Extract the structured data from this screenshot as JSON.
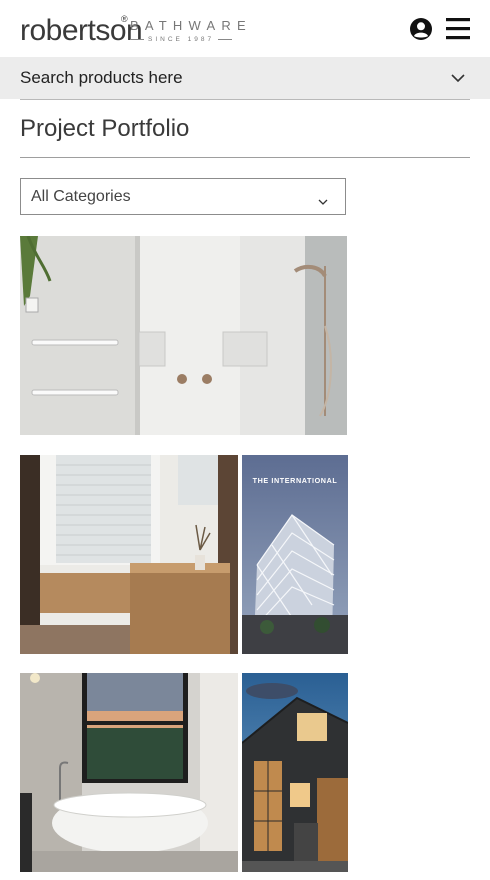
{
  "header": {
    "logo_word": "robertson",
    "logo_reg": "®",
    "logo_sub": "BATHWARE",
    "logo_since": "SINCE 1987",
    "user_icon": "user-circle-icon",
    "menu_icon": "hamburger-menu-icon"
  },
  "search": {
    "placeholder": "Search products here",
    "chevron_icon": "chevron-down-icon"
  },
  "page": {
    "title": "Project Portfolio"
  },
  "filter": {
    "selected": "All Categories",
    "chevron_icon": "chevron-down-icon"
  },
  "portfolio": {
    "tiles": [
      {
        "name": "white-tiled-shower-photo",
        "caption": ""
      },
      {
        "name": "timber-vanity-bathroom-photo",
        "caption": ""
      },
      {
        "name": "the-international-building-photo",
        "caption": "THE INTERNATIONAL"
      },
      {
        "name": "freestanding-bath-photo",
        "caption": ""
      },
      {
        "name": "dark-clad-house-photo",
        "caption": ""
      }
    ]
  },
  "colors": {
    "search_bg": "#ececec",
    "text": "#2b2b2b",
    "rule": "#b9b9b9"
  }
}
